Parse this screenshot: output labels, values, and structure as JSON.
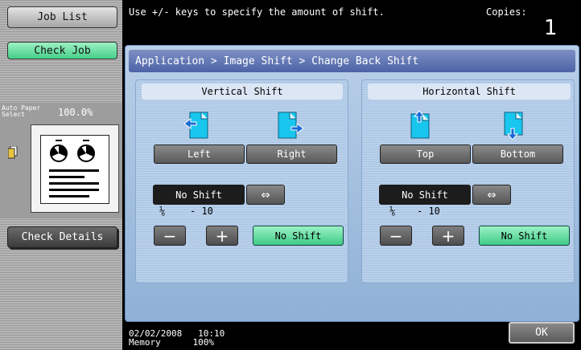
{
  "sidebar": {
    "job_list": "Job List",
    "check_job": "Check Job",
    "auto_paper_line1": "Auto Paper",
    "auto_paper_line2": "Select",
    "zoom": "100.0%",
    "check_details": "Check Details"
  },
  "header": {
    "message": "Use +/- keys to specify the amount of shift.",
    "copies_label": "Copies:",
    "copies_value": "1"
  },
  "breadcrumb": "Application > Image Shift > Change Back Shift",
  "vertical": {
    "title": "Vertical Shift",
    "left_label": "Left",
    "right_label": "Right",
    "value": "No Shift",
    "fraction": "⅙",
    "range": "-  10",
    "minus": "−",
    "plus": "+",
    "no_shift": "No Shift"
  },
  "horizontal": {
    "title": "Horizontal Shift",
    "top_label": "Top",
    "bottom_label": "Bottom",
    "value": "No Shift",
    "fraction": "⅙",
    "range": "-  10",
    "minus": "−",
    "plus": "+",
    "no_shift": "No Shift"
  },
  "footer": {
    "date": "02/02/2008",
    "time": "10:10",
    "memory_label": "Memory",
    "memory_value": "100%",
    "ok": "OK"
  },
  "colors": {
    "accent_green": "#46cf88",
    "breadcrumb_blue": "#4d63a6",
    "panel_blue": "#b9cfe8",
    "icon_cyan": "#19c6ee"
  },
  "icons": [
    "swap-arrows-icon",
    "shift-left-icon",
    "shift-right-icon",
    "shift-top-icon",
    "shift-bottom-icon",
    "document-icon"
  ]
}
